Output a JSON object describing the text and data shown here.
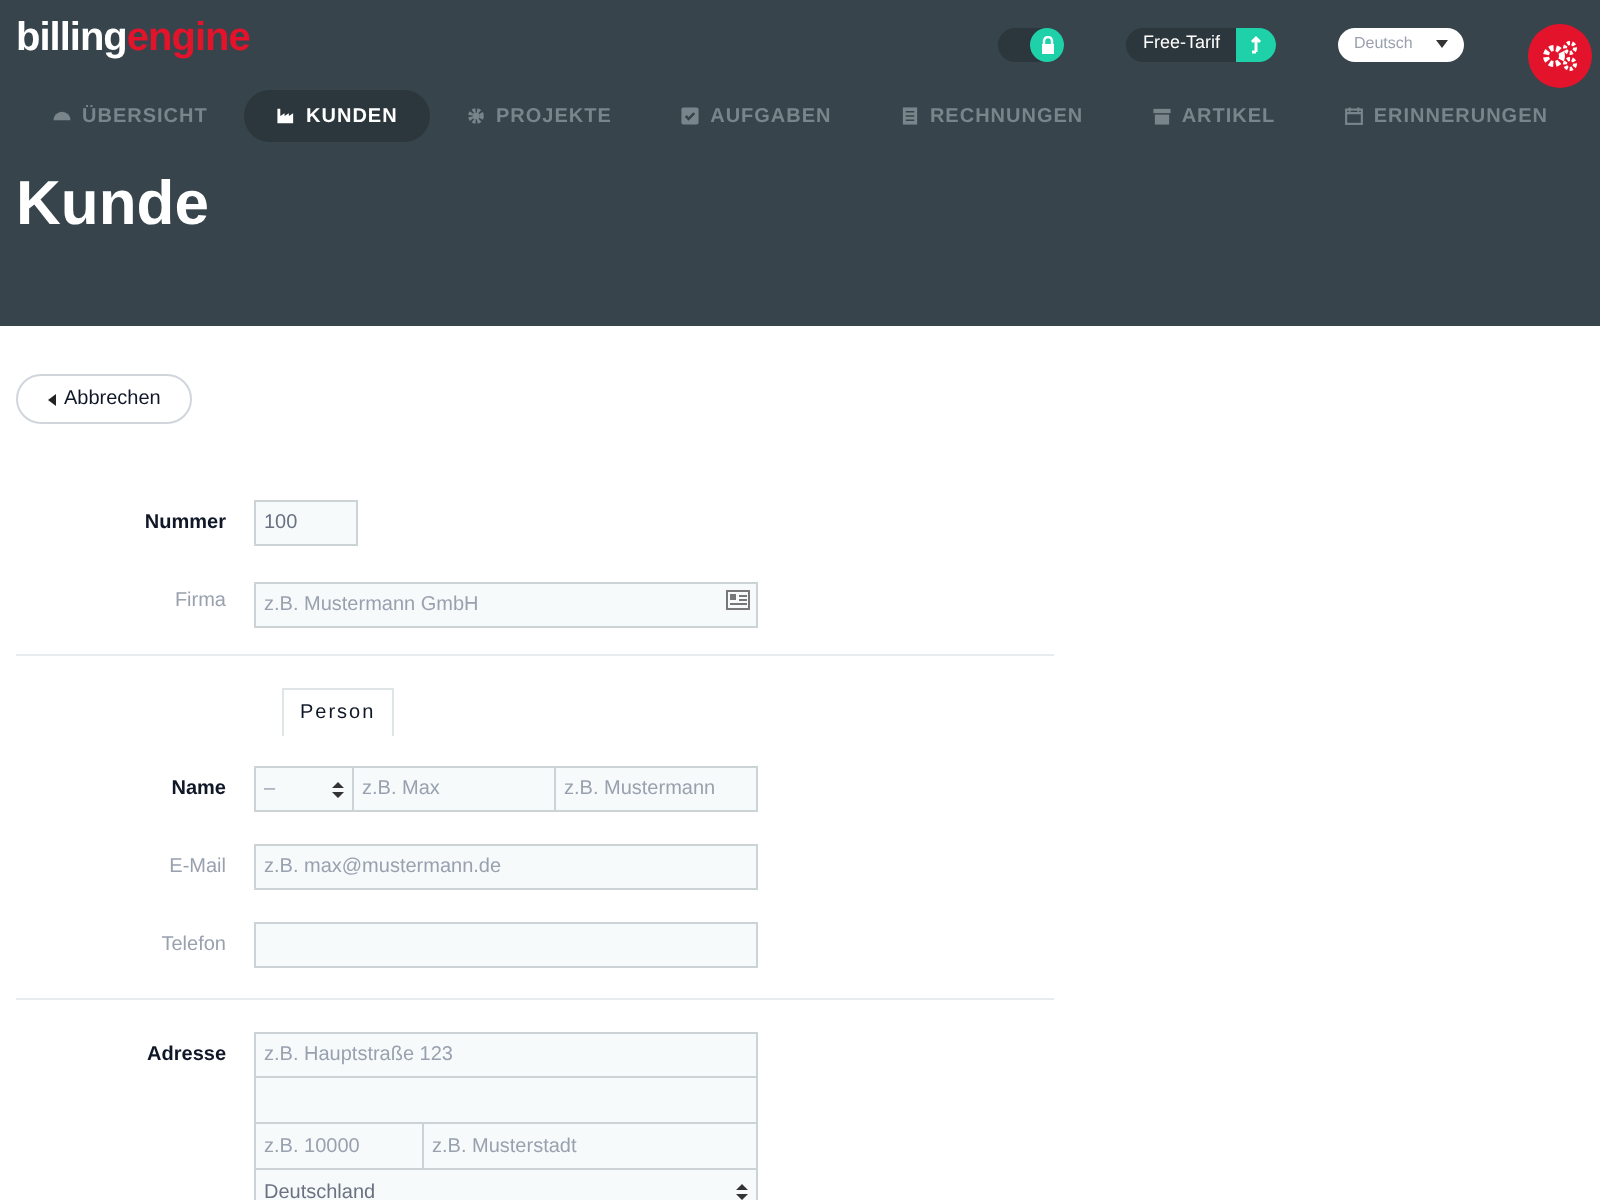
{
  "header": {
    "logo": {
      "part_1": "billing",
      "part_2": "engine"
    },
    "lock_toggle": {
      "on": true
    },
    "plan": {
      "label": "Free-Tarif"
    },
    "language": {
      "value": "Deutsch"
    }
  },
  "nav": [
    {
      "label": "ÜBERSICHT",
      "selected": false
    },
    {
      "label": "KUNDEN",
      "selected": true
    },
    {
      "label": "PROJEKTE",
      "selected": false
    },
    {
      "label": "AUFGABEN",
      "selected": false
    },
    {
      "label": "RECHNUNGEN",
      "selected": false
    },
    {
      "label": "ARTIKEL",
      "selected": false
    },
    {
      "label": "ERINNERUNGEN",
      "selected": false
    }
  ],
  "page_title": "Kunde",
  "back_button": "Abbrechen",
  "form": {
    "nummer": {
      "label": "Nummer",
      "required": true,
      "value": "100"
    },
    "firma": {
      "label": "Firma",
      "required": false,
      "placeholder": "z.B. Mustermann GmbH"
    },
    "tabs": [
      {
        "label": "Person",
        "selected": true
      }
    ],
    "name": {
      "label": "Name",
      "required": true,
      "salutation": "–",
      "first_placeholder": "z.B. Max",
      "last_placeholder": "z.B. Mustermann"
    },
    "email": {
      "label": "E-Mail",
      "required": false,
      "placeholder": "z.B. max@mustermann.de"
    },
    "telefon": {
      "label": "Telefon",
      "required": false
    },
    "adresse": {
      "label": "Adresse",
      "required": true,
      "street_placeholder": "z.B. Hauptstraße 123",
      "zip_placeholder": "z.B. 10000",
      "city_placeholder": "z.B. Musterstadt",
      "country": "Deutschland"
    }
  }
}
